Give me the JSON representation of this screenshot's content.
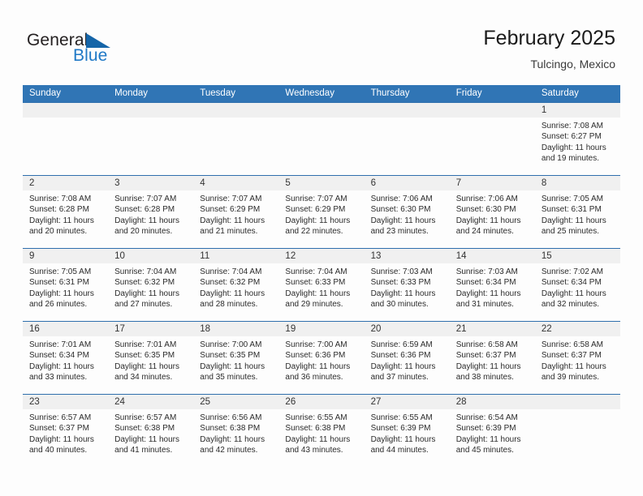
{
  "brand": {
    "name_part1": "General",
    "name_part2": "Blue",
    "triangle_icon": "blue-triangle-icon",
    "color_dark": "#231f20",
    "color_blue": "#2079c6"
  },
  "header": {
    "title": "February 2025",
    "subtitle": "Tulcingo, Mexico"
  },
  "theme": {
    "header_blue": "#3075b5",
    "row_divider": "#2f6fad",
    "day_header_gray": "#f0f0f0",
    "page_background": "#fdfdfd"
  },
  "weekday_headers": [
    "Sunday",
    "Monday",
    "Tuesday",
    "Wednesday",
    "Thursday",
    "Friday",
    "Saturday"
  ],
  "weeks": [
    [
      {
        "date": "",
        "empty": true,
        "sunrise": "",
        "sunset": "",
        "daylight_line1": "",
        "daylight_line2": ""
      },
      {
        "date": "",
        "empty": true,
        "sunrise": "",
        "sunset": "",
        "daylight_line1": "",
        "daylight_line2": ""
      },
      {
        "date": "",
        "empty": true,
        "sunrise": "",
        "sunset": "",
        "daylight_line1": "",
        "daylight_line2": ""
      },
      {
        "date": "",
        "empty": true,
        "sunrise": "",
        "sunset": "",
        "daylight_line1": "",
        "daylight_line2": ""
      },
      {
        "date": "",
        "empty": true,
        "sunrise": "",
        "sunset": "",
        "daylight_line1": "",
        "daylight_line2": ""
      },
      {
        "date": "",
        "empty": true,
        "sunrise": "",
        "sunset": "",
        "daylight_line1": "",
        "daylight_line2": ""
      },
      {
        "date": "1",
        "empty": false,
        "sunrise": "Sunrise: 7:08 AM",
        "sunset": "Sunset: 6:27 PM",
        "daylight_line1": "Daylight: 11 hours",
        "daylight_line2": "and 19 minutes."
      }
    ],
    [
      {
        "date": "2",
        "empty": false,
        "sunrise": "Sunrise: 7:08 AM",
        "sunset": "Sunset: 6:28 PM",
        "daylight_line1": "Daylight: 11 hours",
        "daylight_line2": "and 20 minutes."
      },
      {
        "date": "3",
        "empty": false,
        "sunrise": "Sunrise: 7:07 AM",
        "sunset": "Sunset: 6:28 PM",
        "daylight_line1": "Daylight: 11 hours",
        "daylight_line2": "and 20 minutes."
      },
      {
        "date": "4",
        "empty": false,
        "sunrise": "Sunrise: 7:07 AM",
        "sunset": "Sunset: 6:29 PM",
        "daylight_line1": "Daylight: 11 hours",
        "daylight_line2": "and 21 minutes."
      },
      {
        "date": "5",
        "empty": false,
        "sunrise": "Sunrise: 7:07 AM",
        "sunset": "Sunset: 6:29 PM",
        "daylight_line1": "Daylight: 11 hours",
        "daylight_line2": "and 22 minutes."
      },
      {
        "date": "6",
        "empty": false,
        "sunrise": "Sunrise: 7:06 AM",
        "sunset": "Sunset: 6:30 PM",
        "daylight_line1": "Daylight: 11 hours",
        "daylight_line2": "and 23 minutes."
      },
      {
        "date": "7",
        "empty": false,
        "sunrise": "Sunrise: 7:06 AM",
        "sunset": "Sunset: 6:30 PM",
        "daylight_line1": "Daylight: 11 hours",
        "daylight_line2": "and 24 minutes."
      },
      {
        "date": "8",
        "empty": false,
        "sunrise": "Sunrise: 7:05 AM",
        "sunset": "Sunset: 6:31 PM",
        "daylight_line1": "Daylight: 11 hours",
        "daylight_line2": "and 25 minutes."
      }
    ],
    [
      {
        "date": "9",
        "empty": false,
        "sunrise": "Sunrise: 7:05 AM",
        "sunset": "Sunset: 6:31 PM",
        "daylight_line1": "Daylight: 11 hours",
        "daylight_line2": "and 26 minutes."
      },
      {
        "date": "10",
        "empty": false,
        "sunrise": "Sunrise: 7:04 AM",
        "sunset": "Sunset: 6:32 PM",
        "daylight_line1": "Daylight: 11 hours",
        "daylight_line2": "and 27 minutes."
      },
      {
        "date": "11",
        "empty": false,
        "sunrise": "Sunrise: 7:04 AM",
        "sunset": "Sunset: 6:32 PM",
        "daylight_line1": "Daylight: 11 hours",
        "daylight_line2": "and 28 minutes."
      },
      {
        "date": "12",
        "empty": false,
        "sunrise": "Sunrise: 7:04 AM",
        "sunset": "Sunset: 6:33 PM",
        "daylight_line1": "Daylight: 11 hours",
        "daylight_line2": "and 29 minutes."
      },
      {
        "date": "13",
        "empty": false,
        "sunrise": "Sunrise: 7:03 AM",
        "sunset": "Sunset: 6:33 PM",
        "daylight_line1": "Daylight: 11 hours",
        "daylight_line2": "and 30 minutes."
      },
      {
        "date": "14",
        "empty": false,
        "sunrise": "Sunrise: 7:03 AM",
        "sunset": "Sunset: 6:34 PM",
        "daylight_line1": "Daylight: 11 hours",
        "daylight_line2": "and 31 minutes."
      },
      {
        "date": "15",
        "empty": false,
        "sunrise": "Sunrise: 7:02 AM",
        "sunset": "Sunset: 6:34 PM",
        "daylight_line1": "Daylight: 11 hours",
        "daylight_line2": "and 32 minutes."
      }
    ],
    [
      {
        "date": "16",
        "empty": false,
        "sunrise": "Sunrise: 7:01 AM",
        "sunset": "Sunset: 6:34 PM",
        "daylight_line1": "Daylight: 11 hours",
        "daylight_line2": "and 33 minutes."
      },
      {
        "date": "17",
        "empty": false,
        "sunrise": "Sunrise: 7:01 AM",
        "sunset": "Sunset: 6:35 PM",
        "daylight_line1": "Daylight: 11 hours",
        "daylight_line2": "and 34 minutes."
      },
      {
        "date": "18",
        "empty": false,
        "sunrise": "Sunrise: 7:00 AM",
        "sunset": "Sunset: 6:35 PM",
        "daylight_line1": "Daylight: 11 hours",
        "daylight_line2": "and 35 minutes."
      },
      {
        "date": "19",
        "empty": false,
        "sunrise": "Sunrise: 7:00 AM",
        "sunset": "Sunset: 6:36 PM",
        "daylight_line1": "Daylight: 11 hours",
        "daylight_line2": "and 36 minutes."
      },
      {
        "date": "20",
        "empty": false,
        "sunrise": "Sunrise: 6:59 AM",
        "sunset": "Sunset: 6:36 PM",
        "daylight_line1": "Daylight: 11 hours",
        "daylight_line2": "and 37 minutes."
      },
      {
        "date": "21",
        "empty": false,
        "sunrise": "Sunrise: 6:58 AM",
        "sunset": "Sunset: 6:37 PM",
        "daylight_line1": "Daylight: 11 hours",
        "daylight_line2": "and 38 minutes."
      },
      {
        "date": "22",
        "empty": false,
        "sunrise": "Sunrise: 6:58 AM",
        "sunset": "Sunset: 6:37 PM",
        "daylight_line1": "Daylight: 11 hours",
        "daylight_line2": "and 39 minutes."
      }
    ],
    [
      {
        "date": "23",
        "empty": false,
        "sunrise": "Sunrise: 6:57 AM",
        "sunset": "Sunset: 6:37 PM",
        "daylight_line1": "Daylight: 11 hours",
        "daylight_line2": "and 40 minutes."
      },
      {
        "date": "24",
        "empty": false,
        "sunrise": "Sunrise: 6:57 AM",
        "sunset": "Sunset: 6:38 PM",
        "daylight_line1": "Daylight: 11 hours",
        "daylight_line2": "and 41 minutes."
      },
      {
        "date": "25",
        "empty": false,
        "sunrise": "Sunrise: 6:56 AM",
        "sunset": "Sunset: 6:38 PM",
        "daylight_line1": "Daylight: 11 hours",
        "daylight_line2": "and 42 minutes."
      },
      {
        "date": "26",
        "empty": false,
        "sunrise": "Sunrise: 6:55 AM",
        "sunset": "Sunset: 6:38 PM",
        "daylight_line1": "Daylight: 11 hours",
        "daylight_line2": "and 43 minutes."
      },
      {
        "date": "27",
        "empty": false,
        "sunrise": "Sunrise: 6:55 AM",
        "sunset": "Sunset: 6:39 PM",
        "daylight_line1": "Daylight: 11 hours",
        "daylight_line2": "and 44 minutes."
      },
      {
        "date": "28",
        "empty": false,
        "sunrise": "Sunrise: 6:54 AM",
        "sunset": "Sunset: 6:39 PM",
        "daylight_line1": "Daylight: 11 hours",
        "daylight_line2": "and 45 minutes."
      },
      {
        "date": "",
        "empty": true,
        "sunrise": "",
        "sunset": "",
        "daylight_line1": "",
        "daylight_line2": ""
      }
    ]
  ]
}
